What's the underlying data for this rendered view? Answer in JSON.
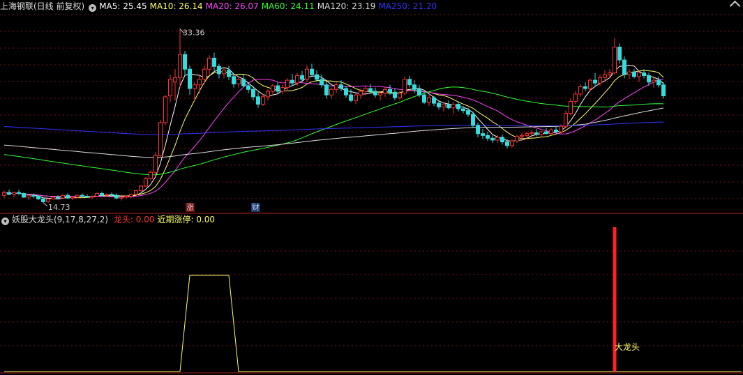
{
  "main_header": {
    "title": "上海钢联(日线 前复权)",
    "ma": [
      {
        "label": "MA5:",
        "value": "25.45",
        "color": "#ffffff"
      },
      {
        "label": "MA10:",
        "value": "26.14",
        "color": "#ffff66"
      },
      {
        "label": "MA20:",
        "value": "26.07",
        "color": "#ff44ff"
      },
      {
        "label": "MA60:",
        "value": "24.11",
        "color": "#33ff33"
      },
      {
        "label": "MA120:",
        "value": "23.19",
        "color": "#dddddd"
      },
      {
        "label": "MA250:",
        "value": "21.20",
        "color": "#3333ff"
      }
    ]
  },
  "indicator_header": {
    "title": "妖股大龙头(9,17,8,27,2)",
    "items": [
      {
        "label": "龙头:",
        "value": "0.00",
        "color": "#ff3333"
      },
      {
        "label": "近期涨停:",
        "value": "0.00",
        "color": "#ffff66"
      }
    ]
  },
  "badges": {
    "zhang": "涨",
    "cai": "财"
  },
  "chart_data": [
    {
      "type": "candlestick",
      "ylim": [
        13.8,
        35.0
      ],
      "high_annotation": "33.36",
      "low_annotation": "14.73",
      "colors": {
        "up": "#ff3333",
        "down": "#33dddd"
      },
      "candles_ohlc": [
        [
          15.3,
          15.8,
          15.0,
          15.6
        ],
        [
          15.6,
          15.9,
          15.3,
          15.4
        ],
        [
          15.4,
          15.7,
          15.1,
          15.6
        ],
        [
          15.6,
          15.9,
          15.3,
          15.5
        ],
        [
          15.5,
          15.6,
          15.0,
          15.1
        ],
        [
          15.1,
          15.4,
          14.8,
          15.3
        ],
        [
          15.3,
          15.5,
          15.0,
          15.2
        ],
        [
          15.2,
          15.3,
          14.8,
          14.9
        ],
        [
          14.9,
          15.1,
          14.5,
          14.6
        ],
        [
          14.6,
          15.0,
          14.5,
          14.9
        ],
        [
          14.9,
          15.2,
          14.8,
          15.1
        ],
        [
          15.1,
          15.3,
          14.9,
          15.0
        ],
        [
          15.0,
          15.4,
          14.9,
          15.3
        ],
        [
          15.3,
          15.5,
          14.9,
          15.0
        ],
        [
          15.0,
          15.2,
          14.8,
          15.1
        ],
        [
          15.1,
          15.4,
          15.0,
          15.3
        ],
        [
          15.3,
          15.5,
          15.0,
          15.2
        ],
        [
          15.2,
          15.4,
          15.0,
          15.1
        ],
        [
          15.1,
          15.3,
          14.9,
          15.2
        ],
        [
          15.2,
          15.6,
          15.1,
          15.5
        ],
        [
          15.5,
          15.7,
          15.2,
          15.3
        ],
        [
          15.3,
          15.5,
          15.1,
          15.4
        ],
        [
          15.4,
          15.6,
          15.2,
          15.3
        ],
        [
          15.3,
          15.5,
          14.9,
          15.0
        ],
        [
          15.0,
          15.2,
          14.73,
          15.1
        ],
        [
          15.1,
          15.3,
          14.9,
          15.2
        ],
        [
          15.2,
          15.5,
          15.0,
          15.4
        ],
        [
          15.4,
          15.9,
          15.3,
          15.8
        ],
        [
          15.8,
          16.4,
          15.7,
          16.3
        ],
        [
          16.3,
          17.3,
          16.2,
          17.1
        ],
        [
          17.1,
          18.0,
          16.9,
          17.8
        ],
        [
          17.8,
          20.0,
          17.6,
          19.6
        ],
        [
          19.6,
          23.5,
          19.4,
          23.2
        ],
        [
          23.2,
          26.2,
          22.9,
          26.0
        ],
        [
          26.1,
          28.4,
          25.4,
          27.9
        ],
        [
          27.6,
          29.0,
          25.6,
          28.1
        ],
        [
          28.1,
          33.36,
          27.0,
          30.6
        ],
        [
          30.6,
          31.0,
          28.4,
          29.0
        ],
        [
          29.0,
          29.4,
          26.2,
          26.9
        ],
        [
          26.9,
          27.6,
          25.6,
          27.3
        ],
        [
          27.3,
          28.4,
          26.4,
          27.9
        ],
        [
          27.9,
          29.4,
          27.4,
          29.0
        ],
        [
          29.0,
          30.5,
          28.4,
          30.2
        ],
        [
          30.2,
          30.8,
          28.8,
          29.3
        ],
        [
          29.3,
          29.6,
          28.0,
          28.5
        ],
        [
          28.5,
          29.2,
          28.0,
          28.9
        ],
        [
          28.9,
          29.4,
          27.8,
          28.2
        ],
        [
          28.2,
          28.6,
          27.0,
          27.4
        ],
        [
          27.4,
          28.2,
          27.0,
          27.9
        ],
        [
          27.9,
          28.4,
          27.0,
          27.2
        ],
        [
          27.2,
          27.6,
          26.4,
          26.8
        ],
        [
          26.8,
          27.2,
          25.6,
          26.0
        ],
        [
          26.0,
          26.5,
          24.8,
          25.2
        ],
        [
          25.2,
          26.3,
          25.0,
          26.0
        ],
        [
          26.0,
          26.8,
          25.6,
          26.6
        ],
        [
          26.6,
          27.4,
          26.2,
          27.2
        ],
        [
          27.2,
          27.6,
          26.4,
          26.6
        ],
        [
          26.6,
          27.3,
          26.3,
          27.0
        ],
        [
          27.0,
          28.0,
          26.6,
          27.8
        ],
        [
          27.8,
          28.5,
          27.2,
          27.5
        ],
        [
          27.5,
          28.6,
          27.2,
          28.3
        ],
        [
          28.3,
          28.8,
          27.6,
          27.9
        ],
        [
          27.9,
          29.4,
          27.6,
          29.0
        ],
        [
          29.0,
          29.6,
          28.2,
          28.4
        ],
        [
          28.4,
          28.9,
          27.6,
          27.9
        ],
        [
          27.9,
          28.4,
          27.0,
          27.3
        ],
        [
          27.3,
          27.7,
          25.8,
          26.2
        ],
        [
          26.2,
          27.0,
          25.8,
          26.8
        ],
        [
          26.8,
          27.6,
          26.4,
          27.3
        ],
        [
          27.3,
          27.8,
          26.6,
          26.9
        ],
        [
          26.9,
          27.2,
          25.9,
          26.2
        ],
        [
          26.2,
          26.8,
          25.4,
          25.6
        ],
        [
          25.6,
          26.4,
          25.2,
          26.2
        ],
        [
          26.2,
          26.9,
          25.8,
          26.6
        ],
        [
          26.6,
          27.2,
          26.2,
          26.9
        ],
        [
          26.9,
          27.4,
          26.4,
          26.6
        ],
        [
          26.6,
          27.0,
          25.9,
          26.2
        ],
        [
          26.2,
          26.6,
          25.6,
          26.4
        ],
        [
          26.4,
          27.1,
          26.0,
          26.8
        ],
        [
          26.8,
          27.3,
          26.2,
          26.5
        ],
        [
          26.5,
          26.9,
          25.6,
          25.9
        ],
        [
          25.9,
          26.6,
          25.6,
          26.4
        ],
        [
          26.4,
          28.2,
          26.2,
          27.9
        ],
        [
          27.9,
          28.3,
          27.0,
          27.3
        ],
        [
          27.3,
          27.8,
          26.4,
          26.8
        ],
        [
          26.8,
          27.3,
          26.0,
          26.2
        ],
        [
          26.2,
          26.6,
          25.2,
          25.4
        ],
        [
          25.4,
          26.2,
          25.0,
          25.9
        ],
        [
          25.9,
          26.1,
          25.0,
          25.3
        ],
        [
          25.3,
          25.6,
          24.6,
          24.9
        ],
        [
          24.9,
          25.4,
          24.4,
          25.2
        ],
        [
          25.2,
          25.6,
          24.6,
          24.8
        ],
        [
          24.8,
          25.4,
          24.2,
          25.2
        ],
        [
          25.2,
          25.5,
          24.4,
          24.7
        ],
        [
          24.7,
          25.0,
          24.2,
          24.5
        ],
        [
          24.5,
          24.8,
          23.8,
          24.1
        ],
        [
          24.1,
          24.4,
          22.6,
          22.9
        ],
        [
          22.9,
          23.2,
          21.6,
          22.0
        ],
        [
          22.0,
          22.5,
          21.4,
          21.8
        ],
        [
          21.8,
          22.2,
          21.2,
          21.5
        ],
        [
          21.5,
          21.8,
          21.0,
          21.3
        ],
        [
          21.3,
          21.9,
          21.0,
          21.6
        ],
        [
          21.6,
          21.9,
          20.8,
          21.1
        ],
        [
          21.1,
          21.4,
          20.4,
          20.7
        ],
        [
          20.7,
          21.4,
          20.5,
          21.2
        ],
        [
          21.2,
          21.9,
          21.0,
          21.7
        ],
        [
          21.7,
          22.1,
          21.3,
          21.8
        ],
        [
          21.8,
          22.2,
          21.4,
          22.0
        ],
        [
          22.0,
          22.4,
          21.6,
          22.1
        ],
        [
          22.1,
          22.5,
          21.7,
          21.9
        ],
        [
          21.9,
          22.3,
          21.6,
          22.2
        ],
        [
          22.2,
          22.6,
          21.9,
          22.0
        ],
        [
          22.0,
          22.6,
          21.8,
          22.4
        ],
        [
          22.4,
          22.8,
          22.0,
          22.2
        ],
        [
          22.2,
          23.0,
          22.0,
          22.8
        ],
        [
          22.8,
          24.5,
          22.6,
          24.2
        ],
        [
          24.2,
          25.8,
          24.0,
          25.5
        ],
        [
          25.5,
          26.6,
          25.2,
          26.3
        ],
        [
          26.3,
          27.4,
          26.0,
          27.1
        ],
        [
          27.1,
          27.6,
          26.6,
          26.9
        ],
        [
          26.9,
          28.0,
          26.6,
          27.8
        ],
        [
          27.8,
          28.6,
          27.2,
          27.5
        ],
        [
          27.5,
          28.4,
          27.2,
          28.1
        ],
        [
          28.1,
          28.9,
          27.7,
          28.4
        ],
        [
          28.4,
          29.0,
          28.0,
          28.6
        ],
        [
          28.6,
          32.4,
          28.4,
          31.4
        ],
        [
          31.4,
          31.8,
          29.6,
          30.0
        ],
        [
          30.0,
          30.4,
          28.0,
          28.4
        ],
        [
          28.4,
          29.0,
          27.9,
          28.7
        ],
        [
          28.7,
          29.0,
          28.0,
          28.2
        ],
        [
          28.2,
          28.8,
          27.6,
          28.6
        ],
        [
          28.6,
          29.0,
          28.0,
          28.3
        ],
        [
          28.3,
          28.6,
          27.2,
          27.6
        ],
        [
          27.6,
          28.2,
          27.0,
          27.8
        ],
        [
          27.8,
          28.2,
          27.0,
          27.3
        ],
        [
          27.3,
          27.6,
          25.8,
          26.1
        ]
      ]
    },
    {
      "type": "line",
      "name": "妖股大龙头",
      "x": [
        0,
        36,
        38,
        46,
        48,
        151
      ],
      "y": [
        0,
        0,
        1,
        1,
        0,
        0
      ],
      "bar_signal": {
        "index": 125,
        "label": "大龙头",
        "color": "#ff2222"
      }
    }
  ]
}
